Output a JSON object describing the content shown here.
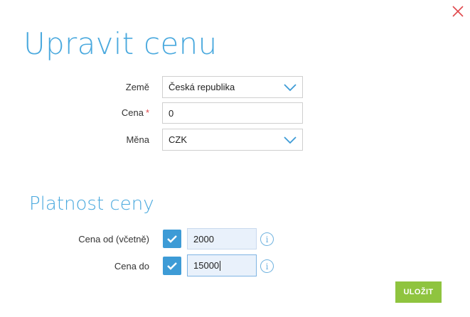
{
  "dialog": {
    "title": "Upravit cenu",
    "close_icon": "close-x-icon"
  },
  "form": {
    "country": {
      "label": "Země",
      "value": "Česká republika"
    },
    "price": {
      "label": "Cena",
      "required_mark": "*",
      "value": "0"
    },
    "currency": {
      "label": "Měna",
      "value": "CZK"
    }
  },
  "validity": {
    "title": "Platnost ceny",
    "from": {
      "label": "Cena od (včetně)",
      "checked": true,
      "value": "2000"
    },
    "to": {
      "label": "Cena do",
      "checked": true,
      "value": "15000"
    },
    "info_icon": "info-icon"
  },
  "actions": {
    "save_label": "ULOŽIT"
  },
  "colors": {
    "accent": "#4aa9de",
    "checkbox": "#3d9bd6",
    "save_button": "#8fc43f",
    "close": "#e0474c",
    "required": "#e0474c"
  }
}
